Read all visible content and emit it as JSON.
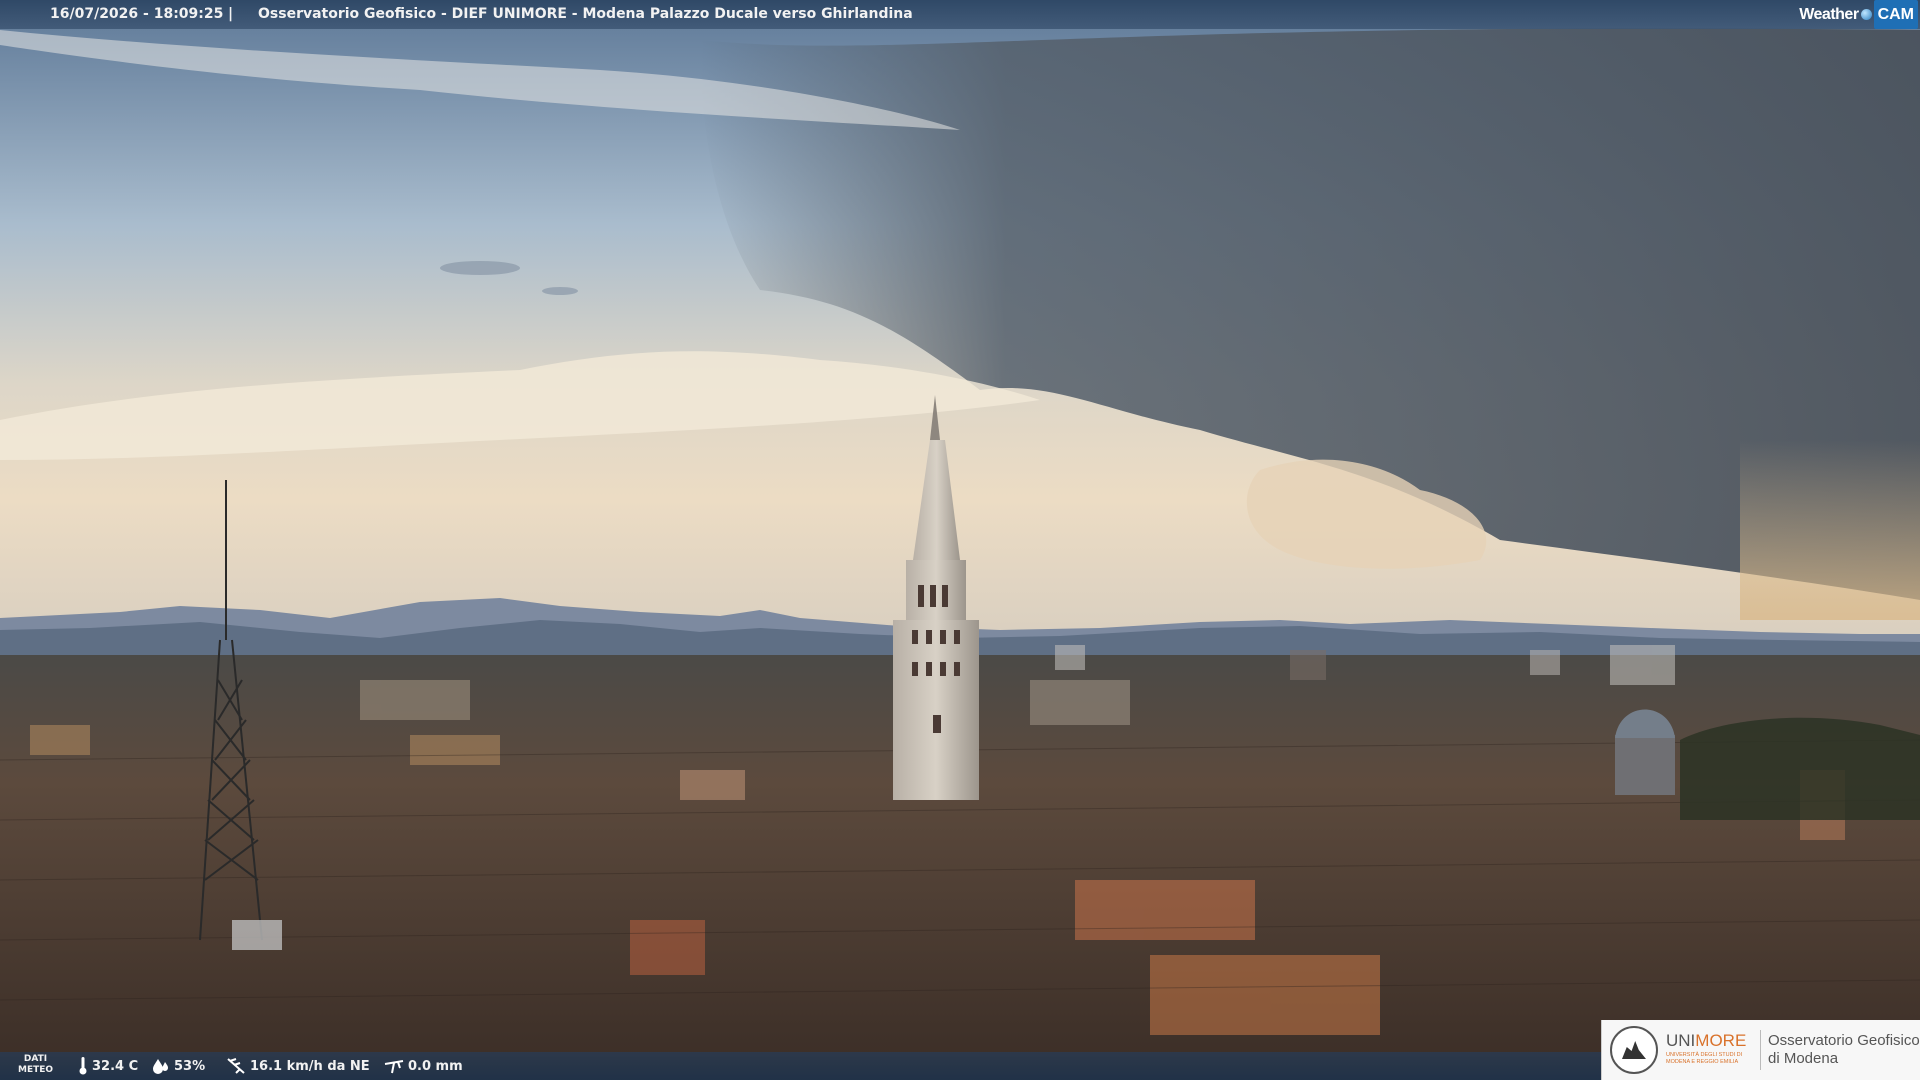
{
  "header": {
    "timestamp": "16/07/2026 - 18:09:25",
    "separator": "|",
    "title": "Osservatorio Geofisico - DIEF UNIMORE - Modena Palazzo Ducale verso Ghirlandina"
  },
  "brand": {
    "part1": "Weather",
    "part2": "CAM"
  },
  "weather": {
    "label_line1": "DATI",
    "label_line2": "METEO",
    "temperature": "32.4 C",
    "humidity": "53%",
    "wind": "16.1 km/h da NE",
    "rain": "0.0 mm",
    "icons": [
      "thermometer-icon",
      "humidity-drop-icon",
      "wind-vane-icon",
      "rain-gauge-icon"
    ]
  },
  "logo": {
    "uni_part1": "UNI",
    "uni_part2": "MORE",
    "uni_sub": "UNIVERSITÀ DEGLI STUDI DI MODENA E REGGIO EMILIA",
    "obs_line1": "Osservatorio Geofisico",
    "obs_line2": "di Modena"
  },
  "colors": {
    "sky_top": "#5b7a9c",
    "sky_glow": "#e9dcc6",
    "storm": "#4e5560",
    "mountains": "#5f6f85",
    "roofs": "#5a4233",
    "accent_orange": "#d9722b"
  }
}
